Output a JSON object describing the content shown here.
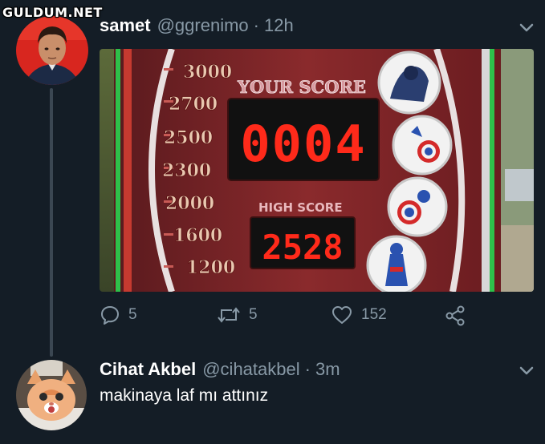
{
  "watermark": "GULDUM.NET",
  "tweet1": {
    "display_name": "samet",
    "handle": "@ggrenimo",
    "separator": "·",
    "time": "12h",
    "avatar_icon": "profile-photo",
    "media": {
      "score_scale": [
        "3000",
        "2700",
        "2500",
        "2300",
        "2000",
        "1600",
        "1200"
      ],
      "your_score_label": "YOUR SCORE",
      "your_score_value": "0004",
      "high_score_label": "HIGH SCORE",
      "high_score_value": "2528"
    },
    "actions": {
      "replies": "5",
      "retweets": "5",
      "likes": "152"
    }
  },
  "tweet2": {
    "display_name": "Cihat Akbel",
    "handle": "@cihatakbel",
    "separator": "·",
    "time": "3m",
    "text": "makinaya laf mı attınız",
    "avatar_icon": "cat-photo"
  },
  "colors": {
    "background": "#141d26",
    "secondary_text": "#8899a6",
    "thread_line": "#3b4752",
    "led_red": "#ff2a1a"
  }
}
